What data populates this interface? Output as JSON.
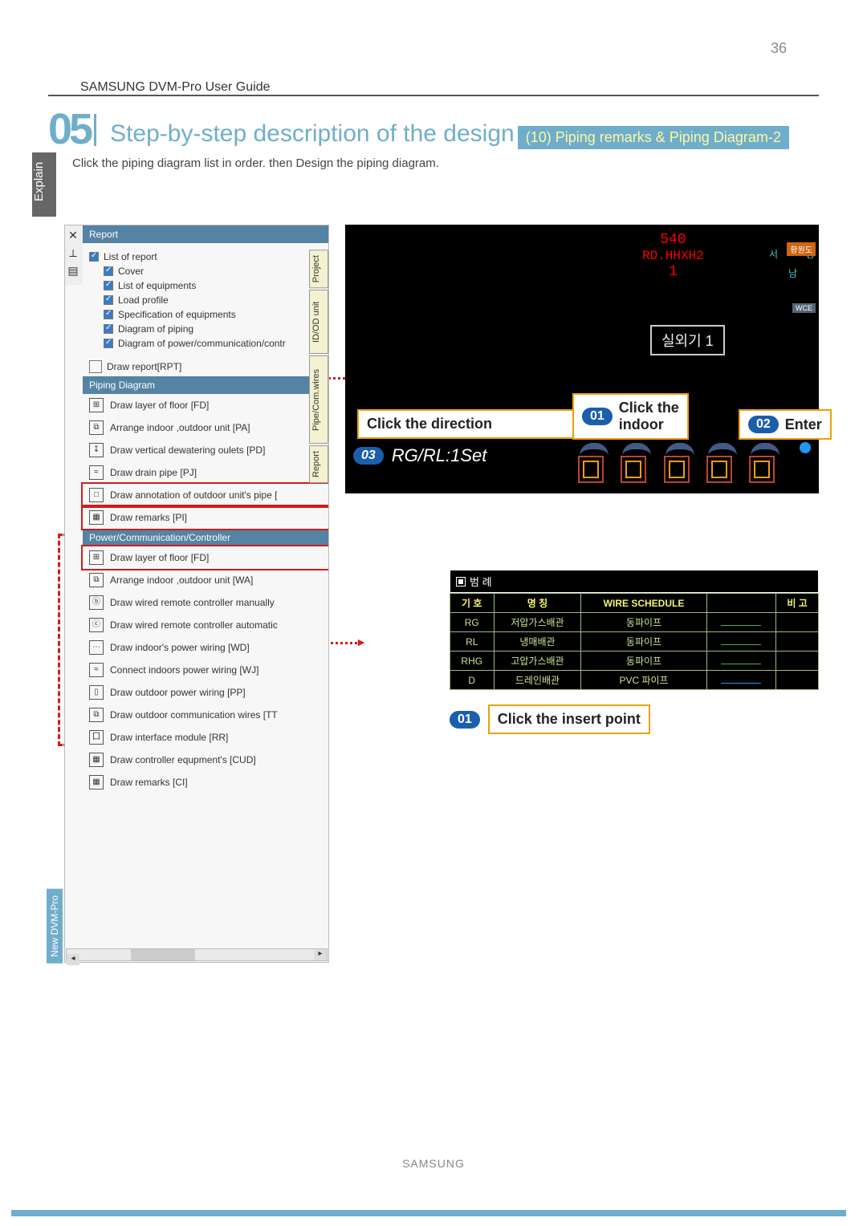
{
  "page_number": "36",
  "guide_title": "SAMSUNG DVM-Pro User Guide",
  "section": {
    "number": "05",
    "title": "Step-by-step description of the design",
    "badge": "(10) Piping remarks  & Piping Diagram-2"
  },
  "explain_label": "Explain",
  "explain_text": "Click the piping diagram list in order. then Design the piping diagram.",
  "side_tab_newdvm": "New DVM-Pro",
  "sidebar": {
    "tabs": [
      "Project",
      "ID/OD unit",
      "Pipe/Com.wires",
      "Report"
    ],
    "report_header": "Report",
    "report_items": {
      "list_of_report": "List of report",
      "cover": "Cover",
      "list_of_equipments": "List of equipments",
      "load_profile": "Load profile",
      "spec_equip": "Specification of equipments",
      "diag_piping": "Diagram of piping",
      "diag_power": "Diagram of power/communication/contr"
    },
    "draw_report": "Draw report[RPT]",
    "piping_header": "Piping Diagram",
    "piping_items": [
      "Draw layer of floor [FD]",
      "Arrange indoor ,outdoor unit [PA]",
      "Draw vertical dewatering oulets [PD]",
      "Draw drain pipe [PJ]",
      "Draw annotation of outdoor unit's pipe [",
      "Draw remarks [PI]"
    ],
    "power_header": "Power/Communication/Controller",
    "power_items": [
      "Draw layer of floor [FD]",
      "Arrange indoor ,outdoor unit [WA]",
      "Draw wired remote controller manually",
      "Draw wired remote controller automatic",
      "Draw indoor's power wiring [WD]",
      "Connect indoors power wiring [WJ]",
      "Draw outdoor power wiring [PP]",
      "Draw outdoor communication wires [TT",
      "Draw interface module [RR]",
      "Draw controller equpment's [CUD]",
      "Draw remarks [CI]"
    ]
  },
  "cad": {
    "value_top": "540",
    "value_mid": "RD.HHXH2",
    "value_bot": "1",
    "outdoor_label": "실외기 1",
    "callout_direction": "Click the direction",
    "callout_indoor_click": "Click the",
    "callout_indoor_line2": "indoor",
    "callout_enter": "Enter",
    "rg_text": "RG/RL:1Set",
    "badge1": "01",
    "badge2": "02",
    "badge3": "03",
    "compass_e": "동",
    "compass_s": "남",
    "compass_w": "서",
    "badge_right1": "황원도",
    "badge_right2": "WCE"
  },
  "legend": {
    "title": "범 례",
    "headers": [
      "기 호",
      "명 칭",
      "WIRE SCHEDULE",
      "",
      "비 고"
    ],
    "rows": [
      {
        "code": "RG",
        "name": "저압가스배관",
        "sched": "동파이프",
        "wire": "green"
      },
      {
        "code": "RL",
        "name": "냉매배관",
        "sched": "동파이프",
        "wire": "green"
      },
      {
        "code": "RHG",
        "name": "고압가스배관",
        "sched": "동파이프",
        "wire": "green"
      },
      {
        "code": "D",
        "name": "드레인배관",
        "sched": "PVC 파이프",
        "wire": "blue"
      }
    ]
  },
  "insert_callout": {
    "badge": "01",
    "text": "Click the insert point"
  },
  "footer": "SAMSUNG"
}
